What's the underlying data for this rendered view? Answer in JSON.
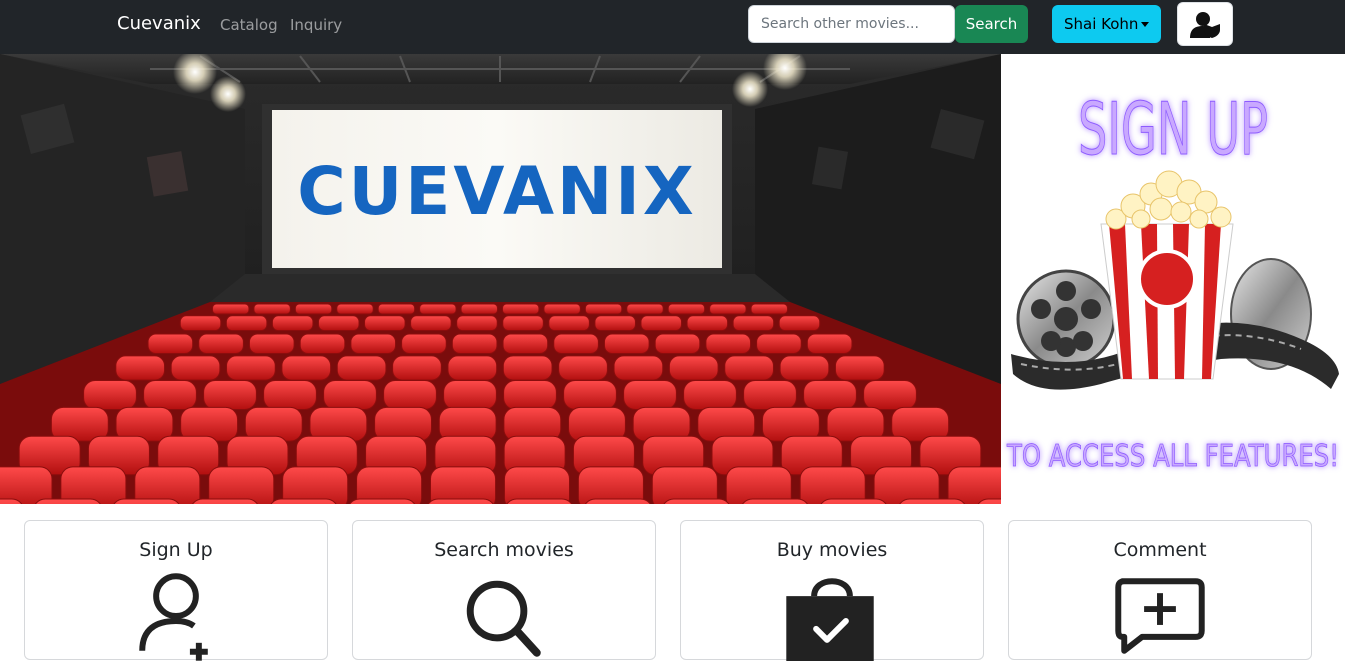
{
  "navbar": {
    "brand": "Cuevanix",
    "links": [
      "Catalog",
      "Inquiry"
    ],
    "search_placeholder": "Search other movies...",
    "search_label": "Search",
    "user_label": "Shai Kohn",
    "admin_icon": "user-shield-icon"
  },
  "hero": {
    "screen_text": "CUEVANIX"
  },
  "promo": {
    "line1": "SIGN UP",
    "line2": "TO ACCESS ALL FEATURES!"
  },
  "cards": [
    {
      "title": "Sign Up",
      "icon": "user-plus-icon"
    },
    {
      "title": "Search movies",
      "icon": "search-icon"
    },
    {
      "title": "Buy movies",
      "icon": "shopping-bag-check-icon"
    },
    {
      "title": "Comment",
      "icon": "comment-plus-icon"
    }
  ],
  "colors": {
    "navbar": "#212529",
    "search_button": "#198754",
    "user_button": "#0dcaf0",
    "seats": "#d41f1f",
    "brand_blue": "#1565c0",
    "neon_purple": "#b388ff"
  }
}
